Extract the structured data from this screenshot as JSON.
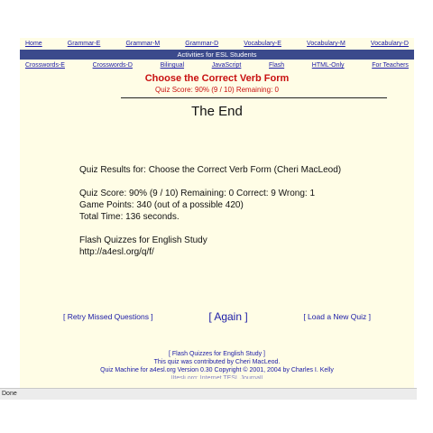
{
  "nav_top": [
    "Home",
    "Grammar-E",
    "Grammar-M",
    "Grammar-D",
    "Vocabulary-E",
    "Vocabulary-M",
    "Vocabulary-D"
  ],
  "banner": "Activities for ESL Students",
  "nav_bottom": [
    "Crosswords-E",
    "Crosswords-D",
    "Bilingual",
    "JavaScript",
    "Flash",
    "HTML-Only",
    "For Teachers"
  ],
  "quiz": {
    "title": "Choose the Correct Verb Form",
    "score_line": "Quiz Score: 90%  (9 / 10)  Remaining: 0"
  },
  "main": {
    "heading": "The End",
    "results_for": "Quiz Results for: Choose the Correct Verb Form (Cheri MacLeod)",
    "score_detail": "Quiz Score: 90%  (9 / 10)  Remaining: 0  Correct: 9  Wrong: 1",
    "game_points": "Game Points: 340 (out of a possible 420)",
    "total_time": "Total Time: 136 seconds.",
    "flash_title": "Flash Quizzes for English Study",
    "flash_url": "http://a4esl.org/q/f/"
  },
  "actions": {
    "retry": "[ Retry Missed Questions ]",
    "again": "[ Again ]",
    "load": "[ Load a New Quiz ]"
  },
  "footer": {
    "link": "[ Flash Quizzes for English Study ]",
    "contributed": "This quiz was contributed by Cheri MacLeod.",
    "machine": "Quiz Machine for a4esl.org Version 0.30     Copyright © 2001, 2004 by Charles I. Kelly",
    "cut": "[Iteslj.org: Internet TESL Journal]"
  },
  "status": "Done"
}
